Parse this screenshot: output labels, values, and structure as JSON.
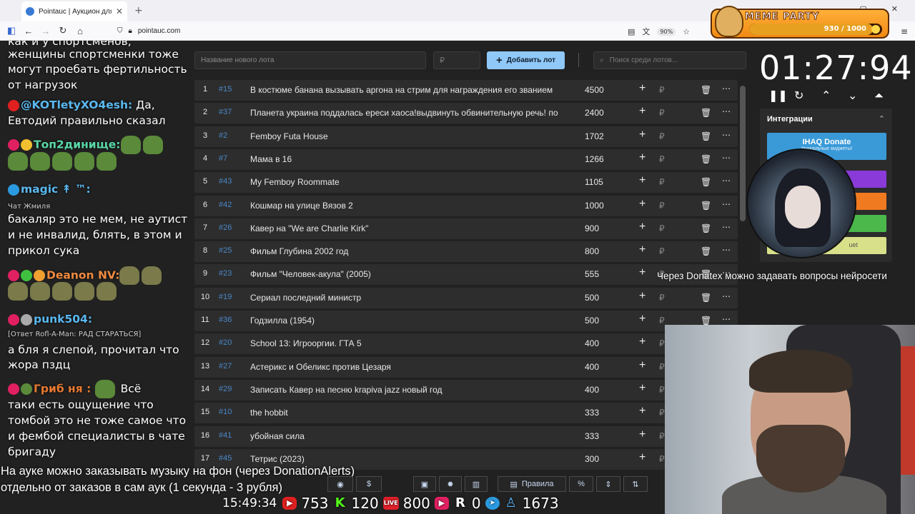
{
  "browser": {
    "tab_title": "Pointauc | Аукцион для стриме",
    "url": "pointauc.com",
    "zoom": "90%"
  },
  "meme_party": {
    "title": "MEME PARTY",
    "progress_text": "930 / 1000",
    "progress_fraction": 0.93
  },
  "chat": {
    "lines": [
      {
        "text": "как и у спортсменов,"
      },
      {
        "text": "женщины спортсменки тоже"
      },
      {
        "text": "могут проебать фертильность"
      },
      {
        "text": "от нагрузок"
      },
      {
        "nick": "@KOTletyXO4esh:",
        "text": " Да,"
      },
      {
        "text": "Евтодий правильно сказал"
      },
      {
        "nick": "Топ2динище:"
      },
      {
        "nick": "magic ↟ ™:"
      },
      {
        "text": "Чат Жмиля"
      },
      {
        "text": "бакаляр это не мем, не аутист"
      },
      {
        "text": "и не инвалид, блять, в этом и"
      },
      {
        "text": "прикол сука"
      },
      {
        "nick": "Deanon NV:"
      },
      {
        "nick": "punk504:"
      },
      {
        "text": "[Ответ Rofl-A-Man: РАД СТАРАТЬСЯ]"
      },
      {
        "text": "а бля я  слепой, прочитал что"
      },
      {
        "text": "жора пздц"
      },
      {
        "nick": "Гриб ня : ",
        "text": " Всё"
      },
      {
        "text": "таки есть ощущение что"
      },
      {
        "text": "томбой это не тоже самое что"
      },
      {
        "text": "и фембой специалисты в чате"
      },
      {
        "text": "бригаду"
      }
    ]
  },
  "controls": {
    "new_lot_placeholder": "Название нового лота",
    "amount_placeholder": "₽",
    "add_button": "Добавить лот",
    "search_placeholder": "Поиск среди лотов..."
  },
  "lots": [
    {
      "num": "1",
      "id": "#15",
      "name": "В костюме банана вызывать аргона на стрим для награждения его званием",
      "amount": "4500"
    },
    {
      "num": "2",
      "id": "#37",
      "name": "Планета украина поддалась ереси хаоса!выдвинуть обвинительную речь! по",
      "amount": "2400"
    },
    {
      "num": "3",
      "id": "#2",
      "name": "Femboy Futa House",
      "amount": "1702"
    },
    {
      "num": "4",
      "id": "#7",
      "name": "Мама в 16",
      "amount": "1266"
    },
    {
      "num": "5",
      "id": "#43",
      "name": "My Femboy Roommate",
      "amount": "1105"
    },
    {
      "num": "6",
      "id": "#42",
      "name": "Кошмар на улице Вязов 2",
      "amount": "1000"
    },
    {
      "num": "7",
      "id": "#26",
      "name": "Кавер на \"We are Charlie Kirk\"",
      "amount": "900"
    },
    {
      "num": "8",
      "id": "#25",
      "name": "Фильм Глубина 2002 год",
      "amount": "800"
    },
    {
      "num": "9",
      "id": "#23",
      "name": "Фильм \"Человек-акула\" (2005)",
      "amount": "555"
    },
    {
      "num": "10",
      "id": "#19",
      "name": "Сериал последний министр",
      "amount": "500"
    },
    {
      "num": "11",
      "id": "#36",
      "name": "Годзилла (1954)",
      "amount": "500"
    },
    {
      "num": "12",
      "id": "#20",
      "name": "School 13: Игрооргии. ГТА 5",
      "amount": "400"
    },
    {
      "num": "13",
      "id": "#27",
      "name": "Астерикс и Обеликс против Цезаря",
      "amount": "400"
    },
    {
      "num": "14",
      "id": "#29",
      "name": "Записать Кавер на песню krapiva jazz новый год",
      "amount": "400"
    },
    {
      "num": "15",
      "id": "#10",
      "name": "the hobbit",
      "amount": "333"
    },
    {
      "num": "16",
      "id": "#41",
      "name": "убойная сила",
      "amount": "333"
    },
    {
      "num": "17",
      "id": "#45",
      "name": "Тетрис (2023)",
      "amount": "300"
    }
  ],
  "row_icons": {
    "plus": "+",
    "rub": "₽",
    "trash": "🗑",
    "more": "⋯"
  },
  "timer": {
    "value": "01:27:94"
  },
  "integrations": {
    "title": "Интеграции",
    "ihaq": "IHAQ Donate",
    "ihaq_sub": "Уникальные виджеты!",
    "bouquet": "uet"
  },
  "overlay": {
    "donatex": "Через Donatex можно задавать вопросы нейросети",
    "music_line1": "На ауке можно заказывать музыку на фон (через DonationAlerts)",
    "music_line2": "отдельно от заказов в сам аук (1 секунда - 3 рубля)"
  },
  "toolbar": {
    "rules": "Правила",
    "percent": "%"
  },
  "stats": {
    "clock": "15:49:34",
    "youtube": "753",
    "kick": "120",
    "live": "800",
    "vk": "0",
    "telegram": "",
    "viewers": "1673"
  }
}
